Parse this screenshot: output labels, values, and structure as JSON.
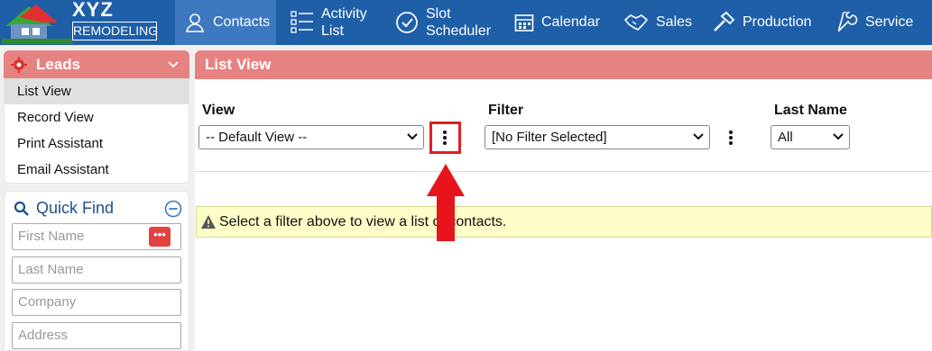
{
  "logo": {
    "line1": "XYZ",
    "line2": "REMODELING"
  },
  "nav": [
    {
      "label": "Contacts",
      "icon": "person-icon",
      "active": true
    },
    {
      "label": "Activity List",
      "line1": "Activity",
      "line2": "List",
      "icon": "checklist-icon"
    },
    {
      "label": "Slot Scheduler",
      "line1": "Slot",
      "line2": "Scheduler",
      "icon": "check-circle-icon"
    },
    {
      "label": "Calendar",
      "icon": "calendar-icon"
    },
    {
      "label": "Sales",
      "icon": "handshake-icon"
    },
    {
      "label": "Production",
      "icon": "hammer-icon"
    },
    {
      "label": "Service",
      "icon": "wrench-icon"
    }
  ],
  "sidebar": {
    "leads_title": "Leads",
    "leads_items": [
      "List View",
      "Record View",
      "Print Assistant",
      "Email Assistant"
    ],
    "quick_find": {
      "title": "Quick Find",
      "fields": [
        {
          "placeholder": "First Name"
        },
        {
          "placeholder": "Last Name"
        },
        {
          "placeholder": "Company"
        },
        {
          "placeholder": "Address"
        }
      ],
      "dots_label": "•••"
    }
  },
  "main": {
    "title": "List View",
    "view_label": "View",
    "view_selected": "-- Default View --",
    "filter_label": "Filter",
    "filter_selected": "[No Filter Selected]",
    "lastname_label": "Last Name",
    "lastname_selected": "All",
    "alert_text": "Select a filter above to view a list of contacts."
  },
  "colors": {
    "nav_bg": "#1e5fa8",
    "header_bg": "#e78282",
    "highlight": "#e02020",
    "alert_bg": "#fefec8"
  }
}
